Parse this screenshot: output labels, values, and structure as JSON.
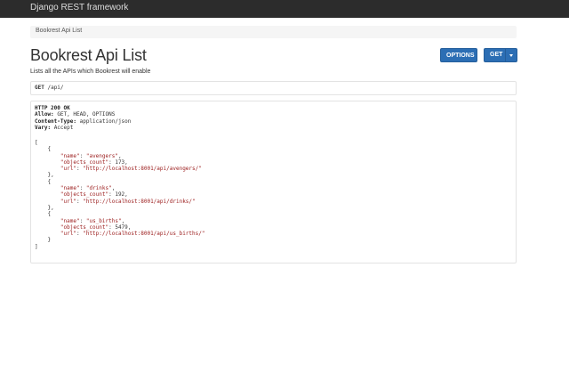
{
  "navbar": {
    "brand": "Django REST framework"
  },
  "breadcrumb": {
    "items": [
      "Bookrest Api List"
    ]
  },
  "page": {
    "title": "Bookrest Api List",
    "description": "Lists all the APIs which Bookrest will enable"
  },
  "buttons": {
    "options": "OPTIONS",
    "get": "GET"
  },
  "request": {
    "method": "GET",
    "path": "/api/"
  },
  "response": {
    "status": "HTTP 200 OK",
    "headers": [
      {
        "key": "Allow:",
        "value": "GET, HEAD, OPTIONS"
      },
      {
        "key": "Content-Type:",
        "value": "application/json"
      },
      {
        "key": "Vary:",
        "value": "Accept"
      }
    ],
    "results": [
      {
        "name": "avengers",
        "objects_count": "173",
        "url": "http://localhost:8001/api/avengers/"
      },
      {
        "name": "drinks",
        "objects_count": "192",
        "url": "http://localhost:8001/api/drinks/"
      },
      {
        "name": "us_births",
        "objects_count": "5479",
        "url": "http://localhost:8001/api/us_births/"
      }
    ]
  },
  "colors": {
    "navbar_bg": "#2c2c2c",
    "button_primary": "#2c6eb4",
    "json_string": "#9a1a1a"
  }
}
